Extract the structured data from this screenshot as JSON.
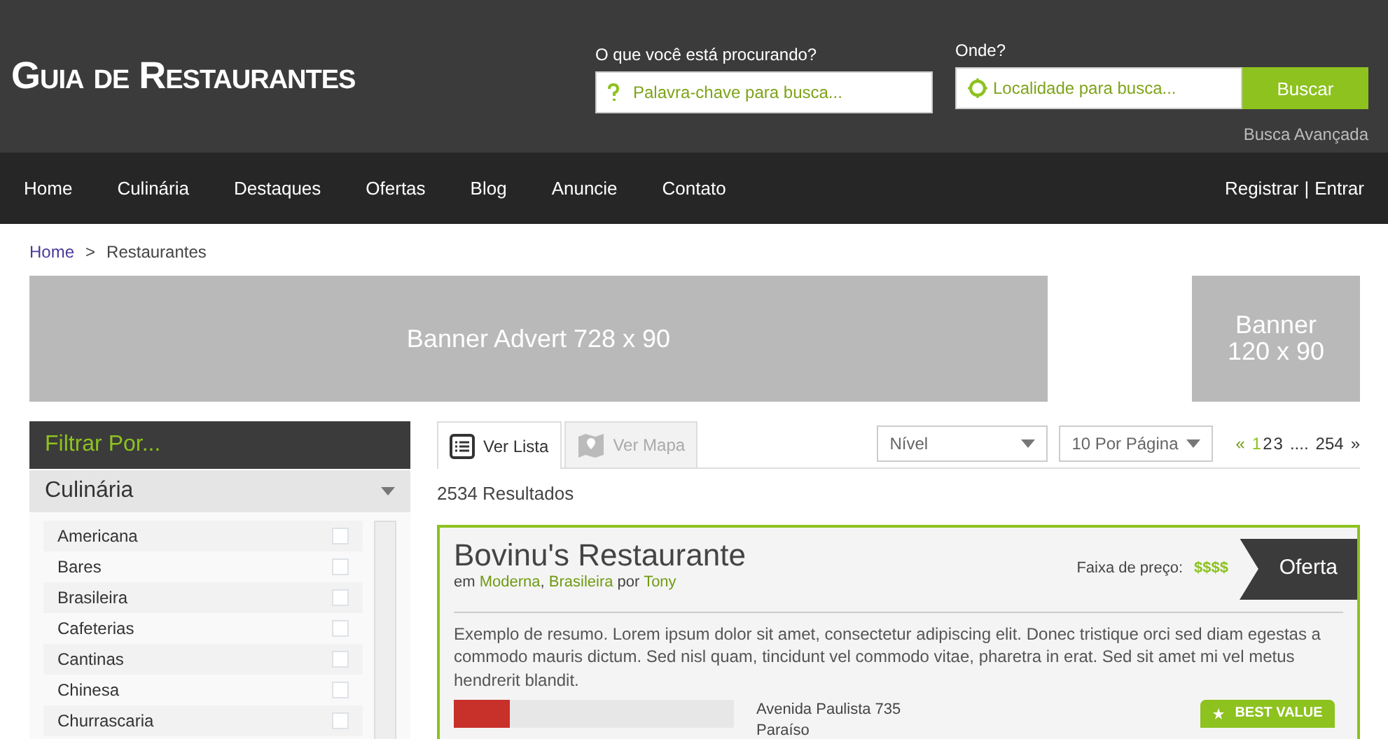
{
  "header": {
    "logo": "Guia de Restaurantes",
    "search": {
      "label": "O que você está procurando?",
      "placeholder": "Palavra-chave para busca..."
    },
    "location": {
      "label": "Onde?",
      "placeholder": "Localidade para busca..."
    },
    "search_button": "Buscar",
    "advanced_link": "Busca Avançada"
  },
  "nav": {
    "items": [
      "Home",
      "Culinária",
      "Destaques",
      "Ofertas",
      "Blog",
      "Anuncie",
      "Contato"
    ],
    "auth": {
      "register": "Registrar",
      "separator": "|",
      "login": "Entrar"
    }
  },
  "breadcrumb": {
    "items": [
      "Home",
      "Restaurantes"
    ],
    "separator": ">"
  },
  "banners": [
    "Banner Advert 728 x 90",
    "Banner 120 x 90"
  ],
  "sidebar": {
    "title": "Filtrar Por...",
    "section": {
      "title": "Culinária",
      "expanded": true,
      "options": [
        {
          "label": "Americana",
          "checked": false
        },
        {
          "label": "Bares",
          "checked": false
        },
        {
          "label": "Brasileira",
          "checked": false
        },
        {
          "label": "Cafeterias",
          "checked": false
        },
        {
          "label": "Cantinas",
          "checked": false
        },
        {
          "label": "Chinesa",
          "checked": false
        },
        {
          "label": "Churrascaria",
          "checked": false
        }
      ]
    }
  },
  "view_tabs": [
    {
      "label": "Ver Lista",
      "selected": true
    },
    {
      "label": "Ver Mapa",
      "selected": false
    }
  ],
  "filters": [
    {
      "value": "Nível"
    },
    {
      "value": "10 Por Página"
    }
  ],
  "pagination": {
    "prev": "«",
    "pages": [
      {
        "label": "1",
        "selected": true
      },
      {
        "label": "2",
        "selected": false
      },
      {
        "label": "3",
        "selected": false
      }
    ],
    "ellipsis": "....",
    "last": "254",
    "next": "»"
  },
  "results_count": "2534 Resultados",
  "listing": {
    "name": "Bovinu's Restaurante",
    "meta": {
      "prefix": "em",
      "categories": [
        "Moderna",
        "Brasileira"
      ],
      "separator": ",",
      "by": "por",
      "author": "Tony"
    },
    "price_label": "Faixa de preço:",
    "price": "$$$$",
    "tag": "Oferta",
    "summary": "Exemplo de resumo. Lorem ipsum dolor sit amet, consectetur adipiscing elit. Donec tristique orci sed diam egestas a commodo mauris dictum. Sed nisl quam, tincidunt vel commodo vitae, pharetra in erat. Sed sit amet mi vel metus hendrerit blandit.",
    "address": [
      "Avenida Paulista 735",
      "Paraíso"
    ],
    "badge": "BEST VALUE"
  }
}
